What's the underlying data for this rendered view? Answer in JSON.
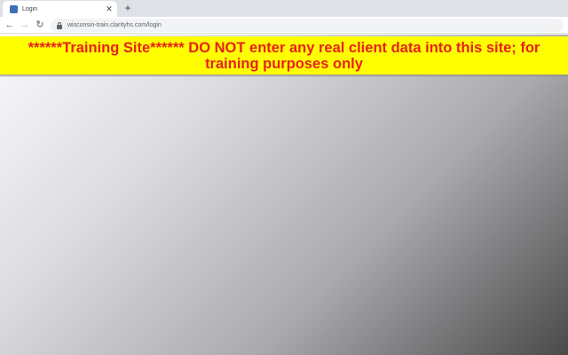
{
  "browser": {
    "tab": {
      "title": "Login",
      "close_glyph": "✕",
      "favicon": "clarity-favicon-icon"
    },
    "new_tab_glyph": "+",
    "nav": {
      "back_glyph": "←",
      "forward_glyph": "→",
      "reload_glyph": "↻"
    },
    "address": {
      "url": "wisconsin-train.clarityhs.com/login",
      "secure_icon": "lock-icon"
    }
  },
  "page": {
    "banner": {
      "text": "******Training Site****** DO NOT enter any real client data into this site; for training purposes only",
      "background": "#ffff00",
      "color": "#e8201a"
    }
  }
}
